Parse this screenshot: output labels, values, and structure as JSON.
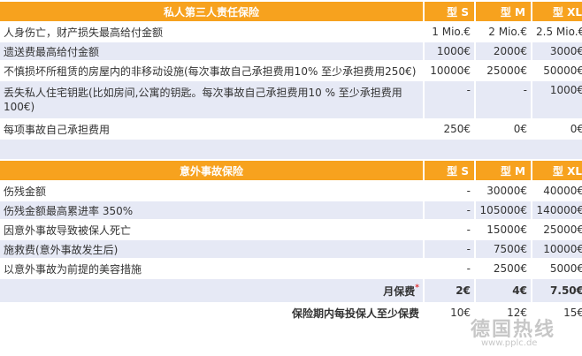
{
  "liability": {
    "title": "私人第三人责任保险",
    "cols": [
      "型 S",
      "型 M",
      "型 XL"
    ],
    "rows": [
      {
        "label": "人身伤亡，财产损失最高给付金额",
        "s": "1 Mio.€",
        "m": "2 Mio.€",
        "xl": "2.5 Mio.€"
      },
      {
        "label": "遗送费最高给付金额",
        "s": "1000€",
        "m": "2000€",
        "xl": "3000€"
      },
      {
        "label": "不慎损坏所租赁的房屋内的非移动设施(每次事故自己承担费用10% 至少承担费用250€)",
        "s": "10000€",
        "m": "25000€",
        "xl": "50000€"
      },
      {
        "label": "丢失私人住宅钥匙(比如房间,公寓的钥匙。每次事故自己承担费用10 % 至少承担费用100€)",
        "s": "-",
        "m": "-",
        "xl": "1000€"
      },
      {
        "label": "每项事故自己承担费用",
        "s": "250€",
        "m": "0€",
        "xl": "0€"
      }
    ]
  },
  "accident": {
    "title": "意外事故保险",
    "cols": [
      "型 S",
      "型 M",
      "型 XL"
    ],
    "rows": [
      {
        "label": "伤残金额",
        "s": "-",
        "m": "30000€",
        "xl": "40000€"
      },
      {
        "label": "伤残金额最高累进率 350%",
        "s": "-",
        "m": "105000€",
        "xl": "140000€"
      },
      {
        "label": "因意外事故导致被保人死亡",
        "s": "-",
        "m": "15000€",
        "xl": "25000€"
      },
      {
        "label": "施救费(意外事故发生后)",
        "s": "-",
        "m": "7500€",
        "xl": "10000€"
      },
      {
        "label": "以意外事故为前提的美容措施",
        "s": "-",
        "m": "2500€",
        "xl": "5000€"
      }
    ],
    "monthly": {
      "label": "月保费",
      "star": "*",
      "s": "2€",
      "m": "4€",
      "xl": "7.50€"
    },
    "minimum": {
      "label": "保险期内每投保人至少保费",
      "s": "10€",
      "m": "12€",
      "xl": "15€"
    }
  },
  "watermark": {
    "main": "德国热线",
    "url": "www.pplc.de"
  }
}
